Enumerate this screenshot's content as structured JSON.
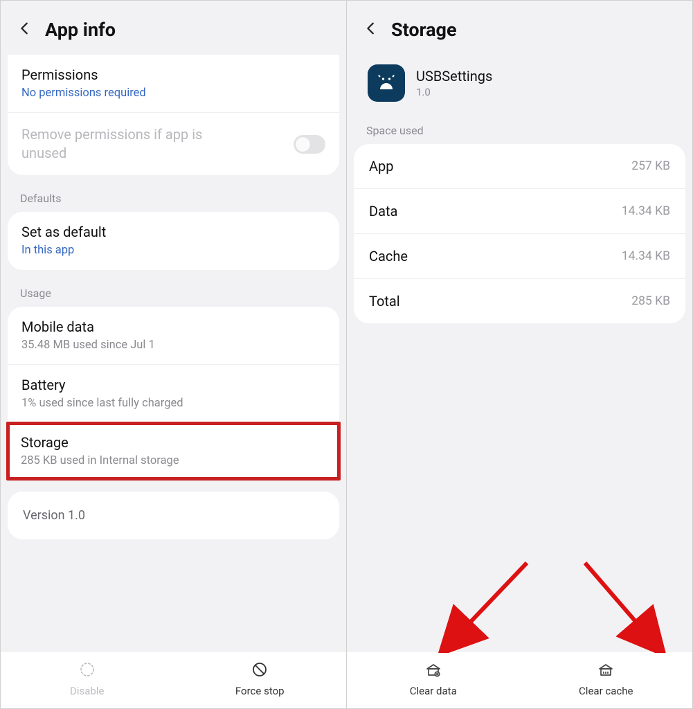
{
  "left": {
    "header_title": "App info",
    "permissions": {
      "title": "Permissions",
      "sub": "No permissions required"
    },
    "remove_perms": "Remove permissions if app is unused",
    "sections": {
      "defaults": "Defaults",
      "usage": "Usage"
    },
    "set_default": {
      "title": "Set as default",
      "sub": "In this app"
    },
    "mobile_data": {
      "title": "Mobile data",
      "sub": "35.48 MB used since Jul 1"
    },
    "battery": {
      "title": "Battery",
      "sub": "1% used since last fully charged"
    },
    "storage": {
      "title": "Storage",
      "sub": "285 KB used in Internal storage"
    },
    "version": "Version 1.0",
    "btns": {
      "disable": "Disable",
      "force_stop": "Force stop"
    }
  },
  "right": {
    "header_title": "Storage",
    "app": {
      "name": "USBSettings",
      "version": "1.0"
    },
    "section_label": "Space used",
    "rows": {
      "app": {
        "k": "App",
        "v": "257 KB"
      },
      "data": {
        "k": "Data",
        "v": "14.34 KB"
      },
      "cache": {
        "k": "Cache",
        "v": "14.34 KB"
      },
      "total": {
        "k": "Total",
        "v": "285 KB"
      }
    },
    "btns": {
      "clear_data": "Clear data",
      "clear_cache": "Clear cache"
    }
  }
}
